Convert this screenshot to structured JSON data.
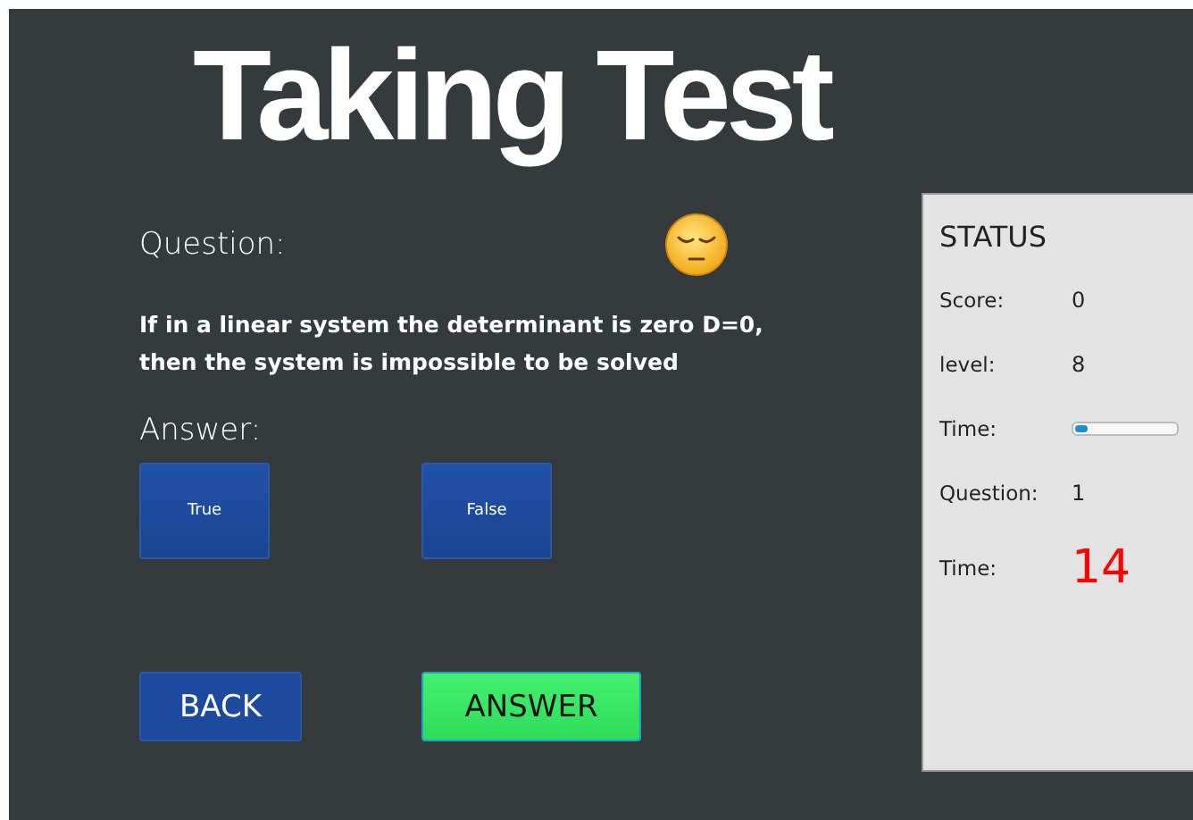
{
  "title": "Taking Test",
  "question": {
    "label": "Question:",
    "text": "If in a linear system the determinant is zero D=0, then the system is impossible to be solved"
  },
  "answer": {
    "label": "Answer:",
    "options": [
      {
        "label": "True"
      },
      {
        "label": "False"
      }
    ]
  },
  "buttons": [
    {
      "label": "BACK",
      "kind": "back"
    },
    {
      "label": "ANSWER",
      "kind": "answer"
    }
  ],
  "status": {
    "title": "STATUS",
    "rows": [
      {
        "kind": "text",
        "label": "Score:",
        "value": "0"
      },
      {
        "kind": "text",
        "label": "level:",
        "value": "8"
      },
      {
        "kind": "progress",
        "label": "Time:",
        "level": 0.12
      },
      {
        "kind": "text",
        "label": "Question:",
        "value": "1"
      },
      {
        "kind": "timer",
        "label": "Time:",
        "value": "14"
      }
    ]
  }
}
